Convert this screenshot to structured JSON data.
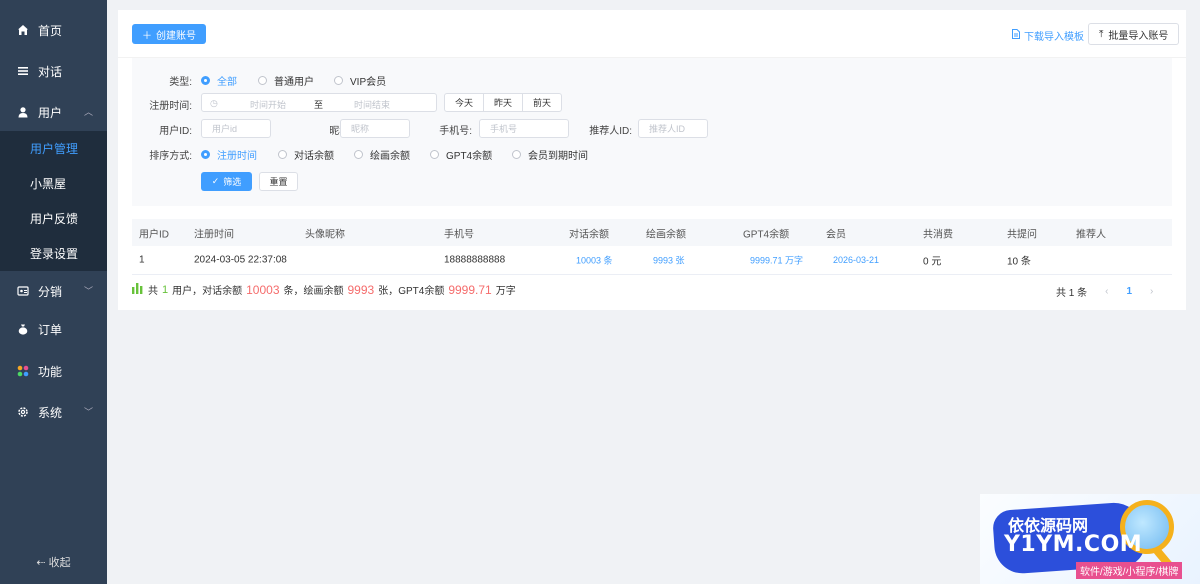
{
  "sidebar": {
    "items": [
      {
        "label": "首页",
        "icon": "home-icon"
      },
      {
        "label": "对话",
        "icon": "list-icon"
      },
      {
        "label": "用户",
        "icon": "user-icon"
      },
      {
        "label": "分销",
        "icon": "share-icon"
      },
      {
        "label": "订单",
        "icon": "money-bag-icon"
      },
      {
        "label": "功能",
        "icon": "apps-icon"
      },
      {
        "label": "系统",
        "icon": "gear-icon"
      }
    ],
    "user_submenu": [
      "用户管理",
      "小黑屋",
      "用户反馈",
      "登录设置"
    ],
    "active_sub": "用户管理",
    "collapse_label": "收起"
  },
  "topbar": {
    "create_label": "创建账号",
    "download_label": "下载导入模板",
    "import_label": "批量导入账号"
  },
  "filter": {
    "type_label": "类型:",
    "type_options": [
      "全部",
      "普通用户",
      "VIP会员"
    ],
    "type_selected": "全部",
    "reg_time_label": "注册时间:",
    "time_start_placeholder": "时间开始",
    "time_sep": "至",
    "time_end_placeholder": "时间结束",
    "quick": [
      "今天",
      "昨天",
      "前天"
    ],
    "user_id_label": "用户ID:",
    "user_id_placeholder": "用户id",
    "nickname_label": "昵称:",
    "nickname_placeholder": "昵称",
    "phone_label": "手机号:",
    "phone_placeholder": "手机号",
    "referrer_label": "推荐人ID:",
    "referrer_placeholder": "推荐人ID",
    "sort_label": "排序方式:",
    "sort_options": [
      "注册时间",
      "对话余额",
      "绘画余额",
      "GPT4余额",
      "会员到期时间"
    ],
    "sort_selected": "注册时间",
    "filter_btn": "筛选",
    "reset_btn": "重置"
  },
  "table": {
    "headers": [
      "用户ID",
      "注册时间",
      "头像昵称",
      "手机号",
      "对话余额",
      "绘画余额",
      "GPT4余额",
      "会员",
      "共消费",
      "共提问",
      "推荐人"
    ],
    "rows": [
      {
        "id": "1",
        "reg_time": "2024-03-05 22:37:08",
        "nickname": "",
        "phone": "18888888888",
        "chat_balance": "10003 条",
        "draw_balance": "9993 张",
        "gpt4_balance": "9999.71 万字",
        "vip": "2026-03-21",
        "spent": "0 元",
        "questions": "10 条",
        "referrer": ""
      }
    ]
  },
  "summary": {
    "p1": "共",
    "users": "1",
    "p2": "用户，对话余额",
    "chat": "10003",
    "p3": "条，绘画余额",
    "draw": "9993",
    "p4": "张，GPT4余额",
    "gpt4": "9999.71",
    "p5": "万字"
  },
  "pager": {
    "total": "共 1 条",
    "current": "1"
  },
  "badge": {
    "line1": "依依源码网",
    "line2": "Y1YM.COM",
    "line3": "软件/游戏/小程序/棋牌"
  }
}
